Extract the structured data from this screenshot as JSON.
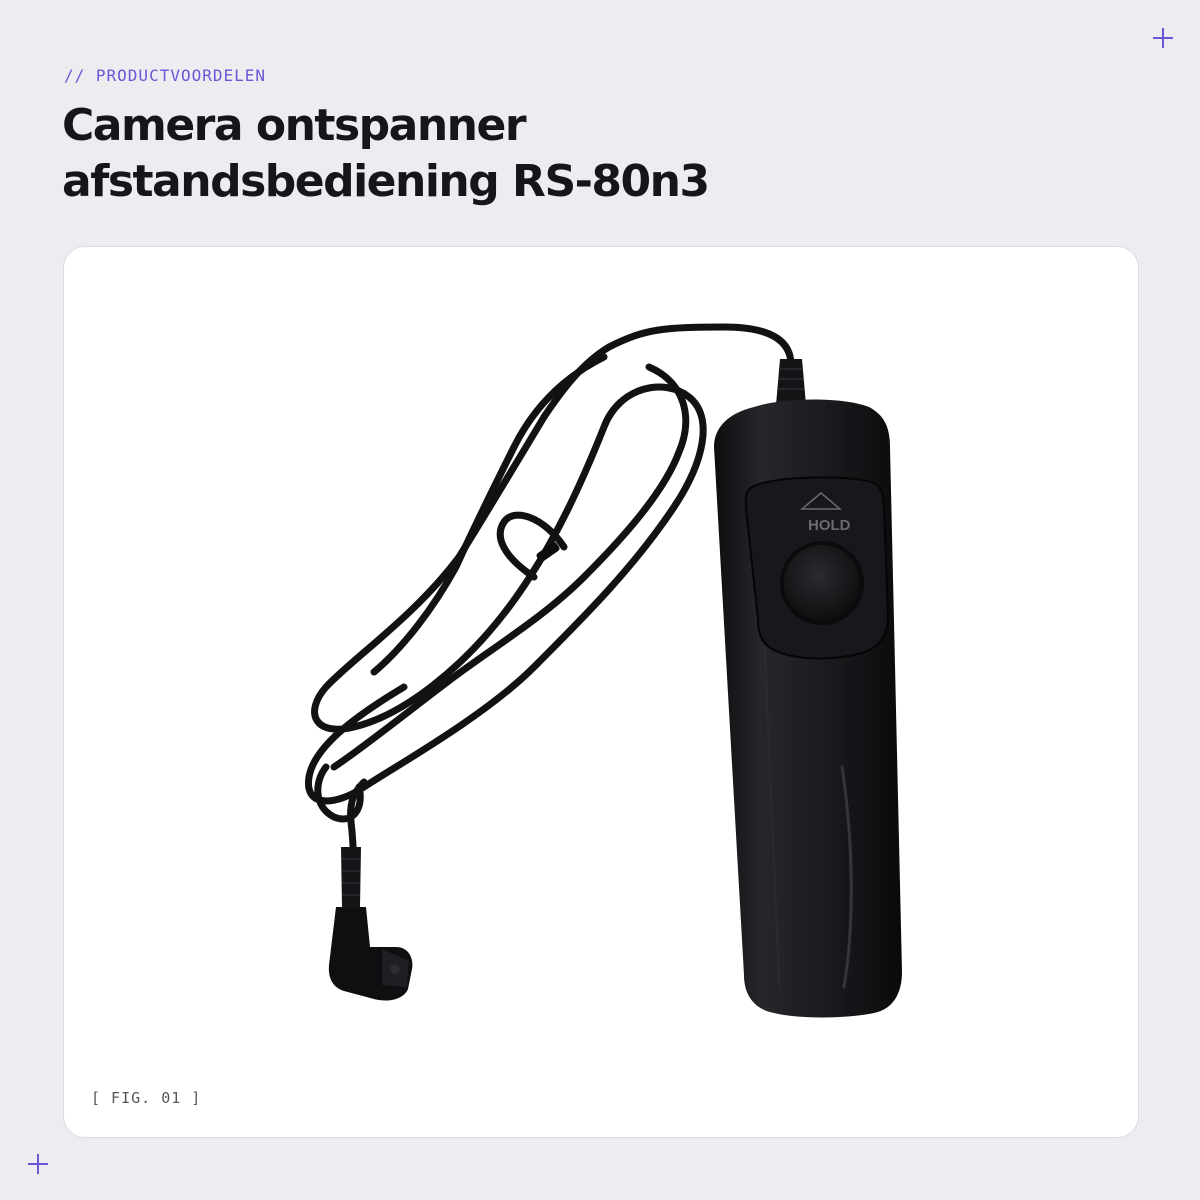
{
  "header": {
    "eyebrow": "// PRODUCTVOORDELEN",
    "title_line_1": "Camera ontspanner",
    "title_line_2": "afstandsbediening RS-80n3"
  },
  "figure": {
    "label": "[ FIG. 01 ]",
    "button_marking": "HOLD"
  },
  "colors": {
    "accent": "#6b56d6",
    "background": "#ecedf1",
    "card": "#ffffff",
    "title": "#15161b"
  }
}
